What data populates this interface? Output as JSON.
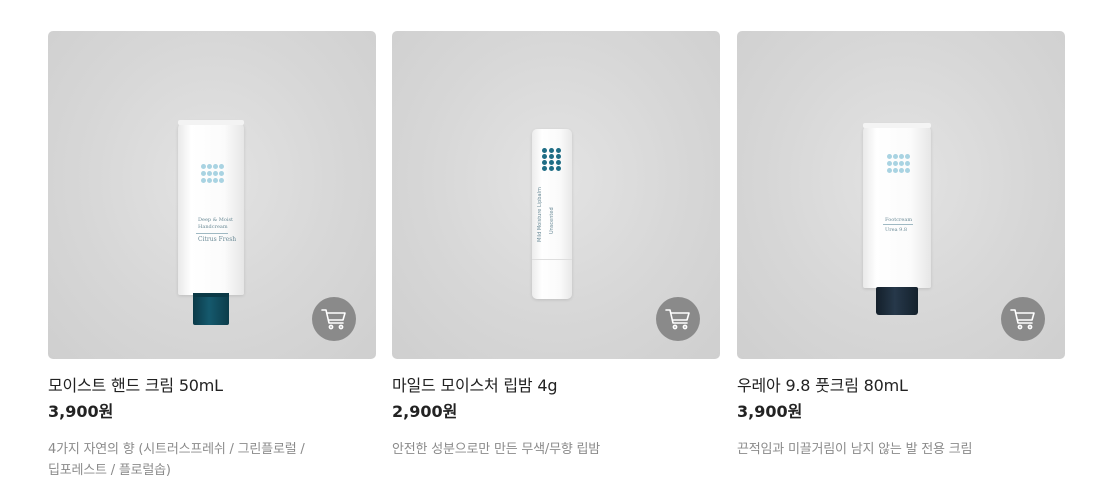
{
  "products": [
    {
      "name": "모이스트 핸드 크림 50mL",
      "price": "3,900원",
      "desc_line1": "4가지 자연의 향 (시트러스프레쉬 / 그린플로럴 /",
      "desc_line2": "딥포레스트 / 플로럴솝)",
      "tube_label_1": "Deep & Moist",
      "tube_label_2": "Handcream",
      "tube_label_3": "Citrus Fresh",
      "cap_color": "#0f4a5c",
      "cart_icon": "cart-icon"
    },
    {
      "name": "마일드 모이스처 립밤 4g",
      "price": "2,900원",
      "desc_line1": "안전한 성분으로만 만든 무색/무향 립밤",
      "desc_line2": "",
      "tube_label_1": "Mild Moisture Lipbalm",
      "tube_label_2": "Unscented",
      "cap_color": "#ffffff",
      "cart_icon": "cart-icon"
    },
    {
      "name": "우레아 9.8 풋크림 80mL",
      "price": "3,900원",
      "desc_line1": "끈적임과 미끌거림이 남지 않는 발 전용 크림",
      "desc_line2": "",
      "tube_label_1": "Footcream",
      "tube_label_2": "Urea 9.8",
      "cap_color": "#1b2a38",
      "cart_icon": "cart-icon"
    }
  ],
  "colors": {
    "card_bg": "#d8d8d8",
    "cart_button": "#8a8a8a",
    "desc_text": "#8b8b8b",
    "dot_accent": "#a9d3e2",
    "dot_dark": "#1f6d85"
  }
}
